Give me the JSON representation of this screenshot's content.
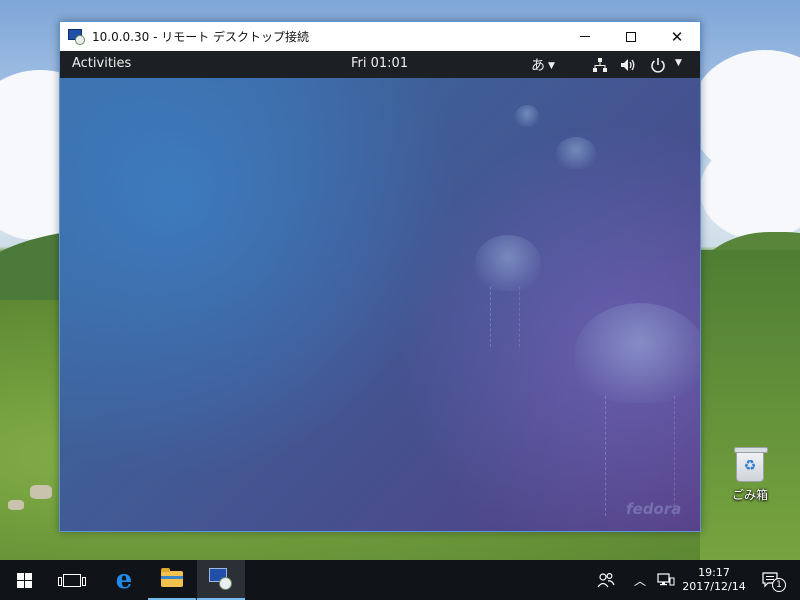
{
  "rdp_window": {
    "title": "10.0.0.30 - リモート デスクトップ接続",
    "accent_color": "#5a93d6"
  },
  "gnome": {
    "activities_label": "Activities",
    "clock": "Fri 01:01",
    "input_method": "あ",
    "topbar_color": "#1c1f24",
    "wallpaper_watermark": "fedora"
  },
  "desktop": {
    "recycle_bin_label": "ごみ箱"
  },
  "taskbar": {
    "time": "19:17",
    "date": "2017/12/14",
    "notification_count": "1",
    "pinned_items": [
      "start-button",
      "task-view",
      "edge",
      "file-explorer",
      "remote-desktop"
    ],
    "accent_color": "#76b9ed"
  }
}
